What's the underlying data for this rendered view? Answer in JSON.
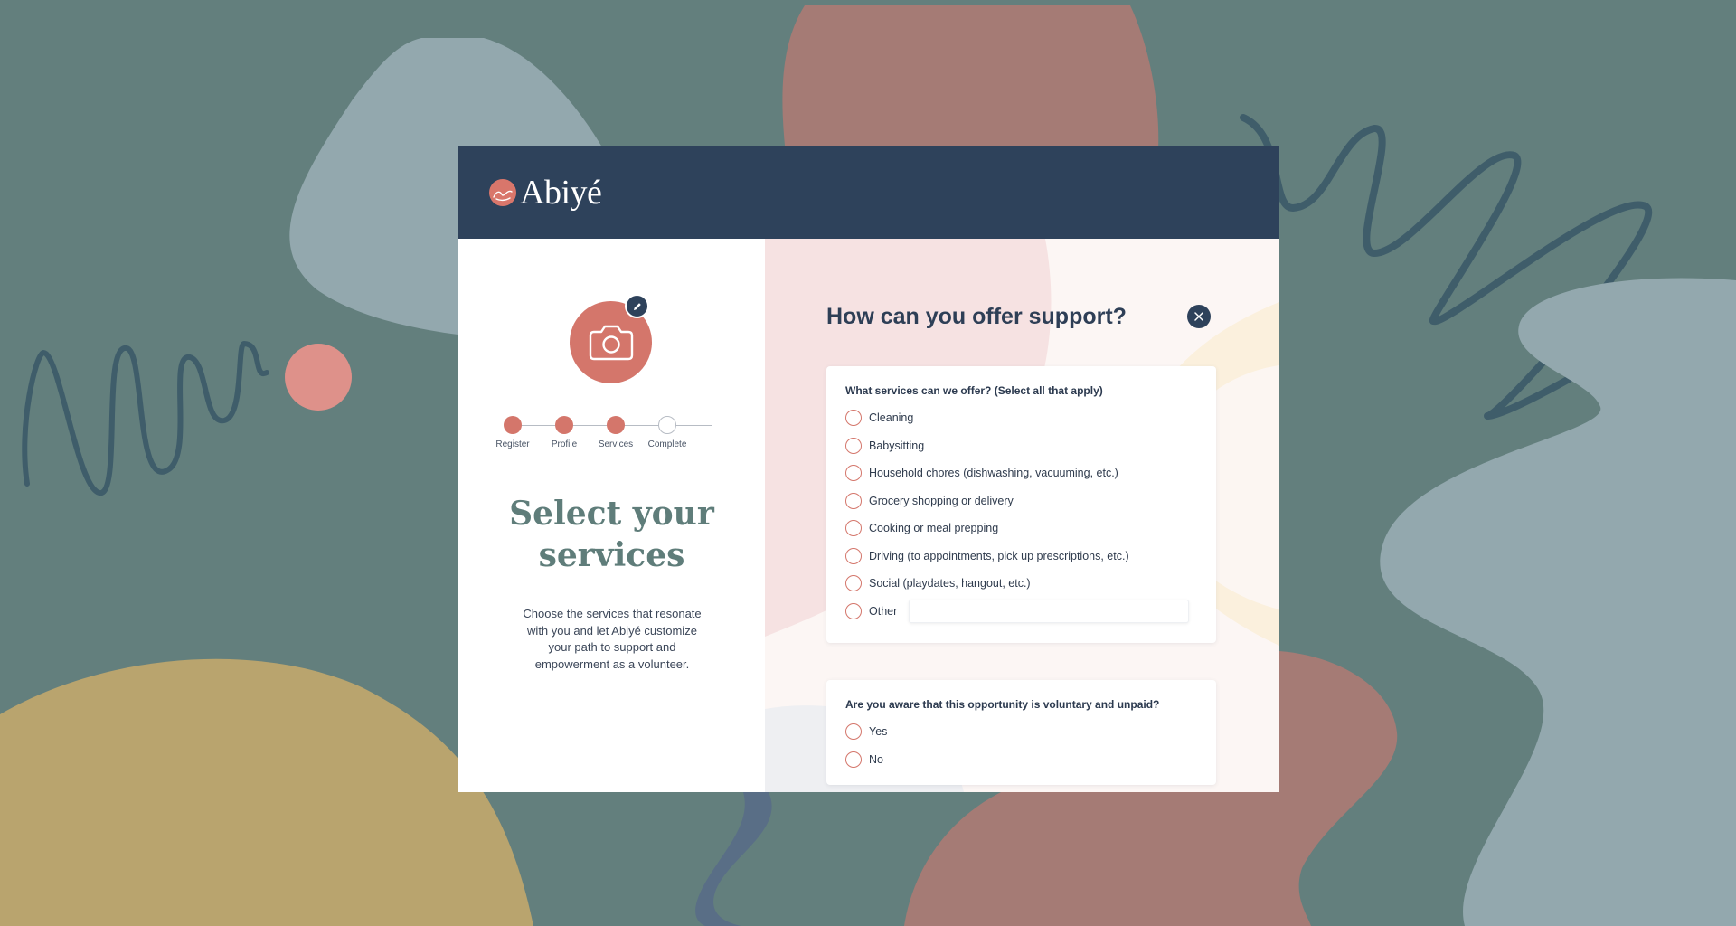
{
  "brand": {
    "name": "Abiyé",
    "logo_icon": "abiye-logo-mark",
    "primary_color": "#2e425b",
    "accent_color": "#d4766b"
  },
  "profile": {
    "avatar_icon": "camera-icon",
    "edit_icon": "pencil-icon"
  },
  "stepper": {
    "steps": [
      {
        "label": "Register",
        "state": "complete"
      },
      {
        "label": "Profile",
        "state": "complete"
      },
      {
        "label": "Services",
        "state": "current"
      },
      {
        "label": "Complete",
        "state": "pending"
      }
    ]
  },
  "left": {
    "title_line1": "Select your",
    "title_line2": "services",
    "description": "Choose the services that resonate with you and let Abiyé customize your path to support and empowerment as a volunteer."
  },
  "form": {
    "title": "How can you offer support?",
    "close_icon": "close-icon",
    "services_question": "What services can we offer? (Select all that apply)",
    "services": [
      "Cleaning",
      "Babysitting",
      "Household chores (dishwashing, vacuuming, etc.)",
      "Grocery shopping or delivery",
      "Cooking or meal prepping",
      "Driving (to appointments, pick up prescriptions, etc.)",
      "Social (playdates, hangout, etc.)"
    ],
    "other_label": "Other",
    "other_value": "",
    "voluntary_question": "Are you aware that this opportunity is voluntary and unpaid?",
    "voluntary_options": [
      "Yes",
      "No"
    ]
  }
}
